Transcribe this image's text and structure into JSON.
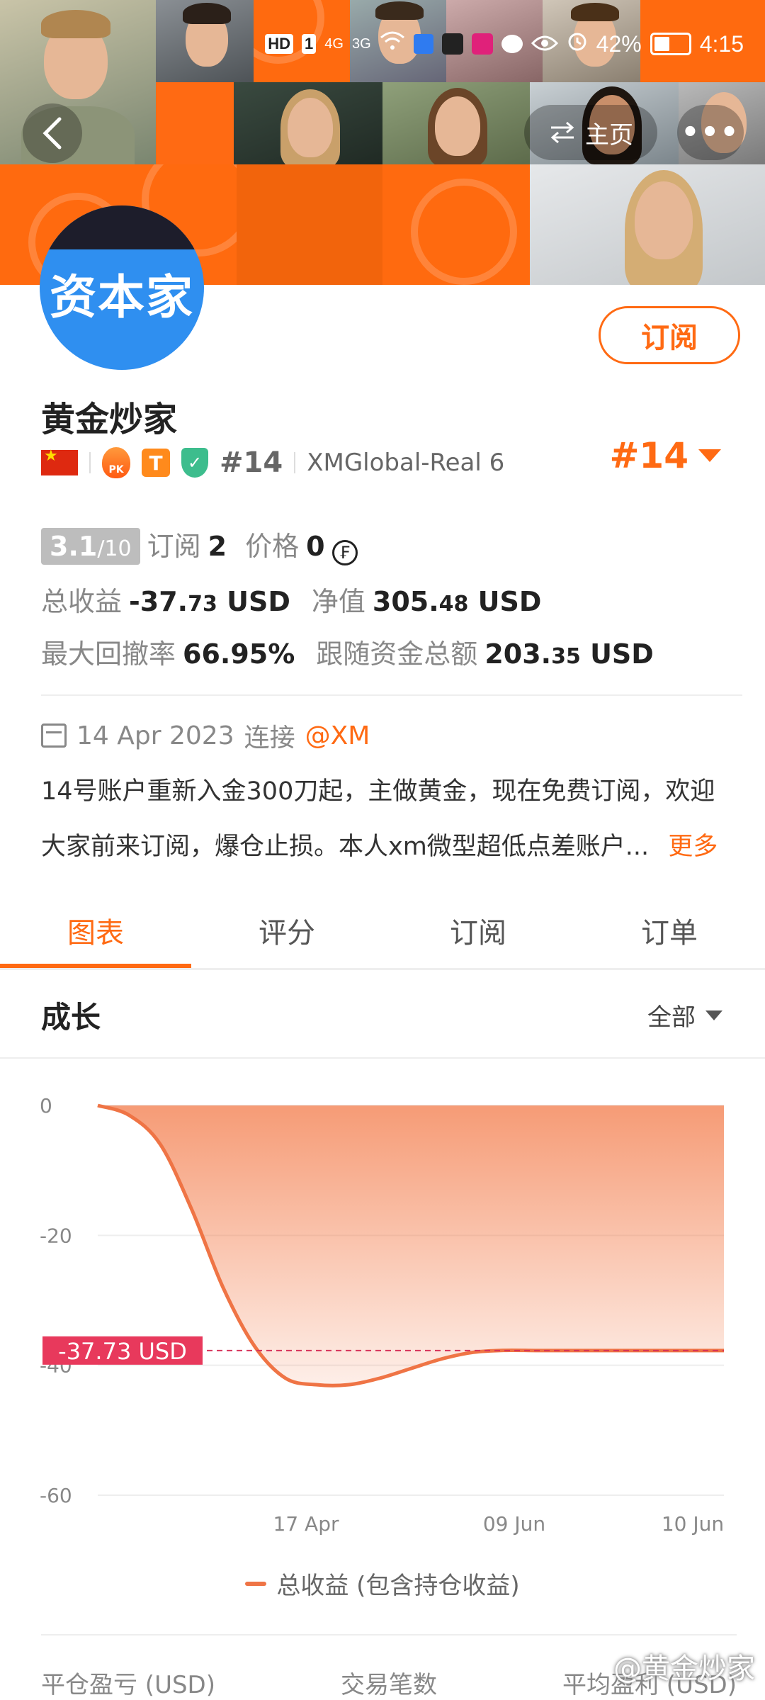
{
  "status_bar": {
    "icons": [
      "HD",
      "1",
      "4G",
      "3G",
      "wifi-icon",
      "app-icon",
      "Soul",
      "唯品会",
      "message-icon",
      "eye-icon",
      "alarm-icon"
    ],
    "battery": "42%",
    "time": "4:15"
  },
  "nav": {
    "home_label": "主页",
    "more_label": "•••"
  },
  "profile": {
    "avatar_text": "资本家",
    "subscribe_label": "订阅",
    "name": "黄金炒家",
    "fire_badge": "PK",
    "t_badge": "T",
    "rank_gray": "#14",
    "broker": "XMGlobal-Real 6",
    "rank_orange": "#14"
  },
  "stats": {
    "score": "3.1",
    "score_max": "/10",
    "subscribe_label": "订阅",
    "subscribe_count": "2",
    "price_label": "价格",
    "price_value": "0",
    "coin_symbol": "₣",
    "total_profit_label": "总收益",
    "total_profit_int": "-37.",
    "total_profit_dec": "73",
    "total_profit_unit": "USD",
    "equity_label": "净值",
    "equity_int": "305.",
    "equity_dec": "48",
    "equity_unit": "USD",
    "drawdown_label": "最大回撤率",
    "drawdown_value": "66.95%",
    "follow_label": "跟随资金总额",
    "follow_int": "203.",
    "follow_dec": "35",
    "follow_unit": "USD"
  },
  "connect": {
    "date": "14 Apr 2023",
    "label": "连接",
    "broker_tag": "@XM"
  },
  "description": {
    "line1": "14号账户重新入金300刀起，主做黄金，现在免费订阅，欢迎",
    "line2": "大家前来订阅，爆仓止损。本人xm微型超低点差账户...",
    "more": "更多"
  },
  "tabs": [
    {
      "label": "图表",
      "active": true
    },
    {
      "label": "评分",
      "active": false
    },
    {
      "label": "订阅",
      "active": false
    },
    {
      "label": "订单",
      "active": false
    }
  ],
  "section": {
    "title": "成长",
    "range": "全部"
  },
  "chart_data": {
    "type": "area",
    "title": "",
    "ylabel": "",
    "xlabel": "",
    "ylim": [
      -60,
      0
    ],
    "y_ticks": [
      "0",
      "-20",
      "-40",
      "-60"
    ],
    "y_tick_values": [
      0,
      -20,
      -40,
      -60
    ],
    "x_tick_labels": [
      "17 Apr",
      "09 Jun",
      "10 Jun"
    ],
    "series": [
      {
        "name": "总收益 (包含持仓收益)",
        "color": "#ef7445",
        "x": [
          0,
          0.05,
          0.1,
          0.15,
          0.2,
          0.25,
          0.3,
          0.35,
          0.4,
          0.45,
          0.5,
          0.55,
          0.6,
          0.65,
          0.7,
          0.75,
          0.8,
          0.85,
          0.9,
          0.95,
          1.0
        ],
        "values": [
          0,
          -1.5,
          -6,
          -16,
          -28,
          -37,
          -42,
          -43,
          -43,
          -42,
          -40.5,
          -39,
          -38,
          -37.7,
          -37.73,
          -37.73,
          -37.73,
          -37.73,
          -37.73,
          -37.73,
          -37.73
        ]
      }
    ],
    "current_value_label": "-37.73 USD",
    "current_value": -37.73,
    "grid": true
  },
  "legend": {
    "label": "总收益 (包含持仓收益)"
  },
  "bottom": {
    "labels": [
      "平仓盈亏 (USD)",
      "交易笔数",
      "平均盈利 (USD)"
    ],
    "watermark": "@黄金炒家"
  }
}
